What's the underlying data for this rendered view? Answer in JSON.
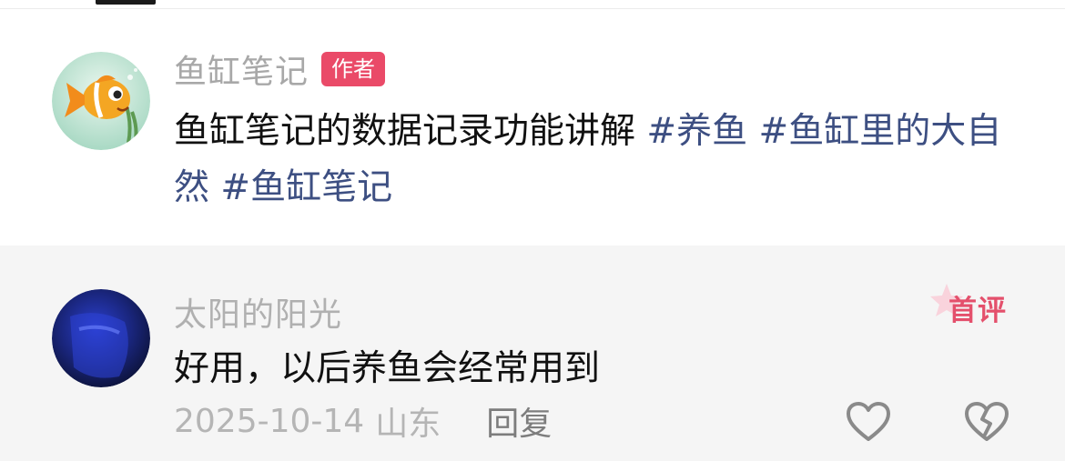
{
  "post": {
    "author": "鱼缸笔记",
    "author_badge": "作者",
    "text": "鱼缸笔记的数据记录功能讲解",
    "tags": [
      "#养鱼",
      "#鱼缸里的大自然",
      "#鱼缸笔记"
    ]
  },
  "comment": {
    "user": "太阳的阳光",
    "first_badge": "首评",
    "text": "好用，以后养鱼会经常用到",
    "date": "2025-10-14",
    "location": "山东",
    "reply_label": "回复"
  },
  "colors": {
    "tag": "#3d4f82",
    "badge": "#ea4a68",
    "first_badge": "#e4506c",
    "comment_bg": "#f5f5f5"
  },
  "icons": {
    "like": "heart-outline-icon",
    "dislike": "broken-heart-icon"
  }
}
